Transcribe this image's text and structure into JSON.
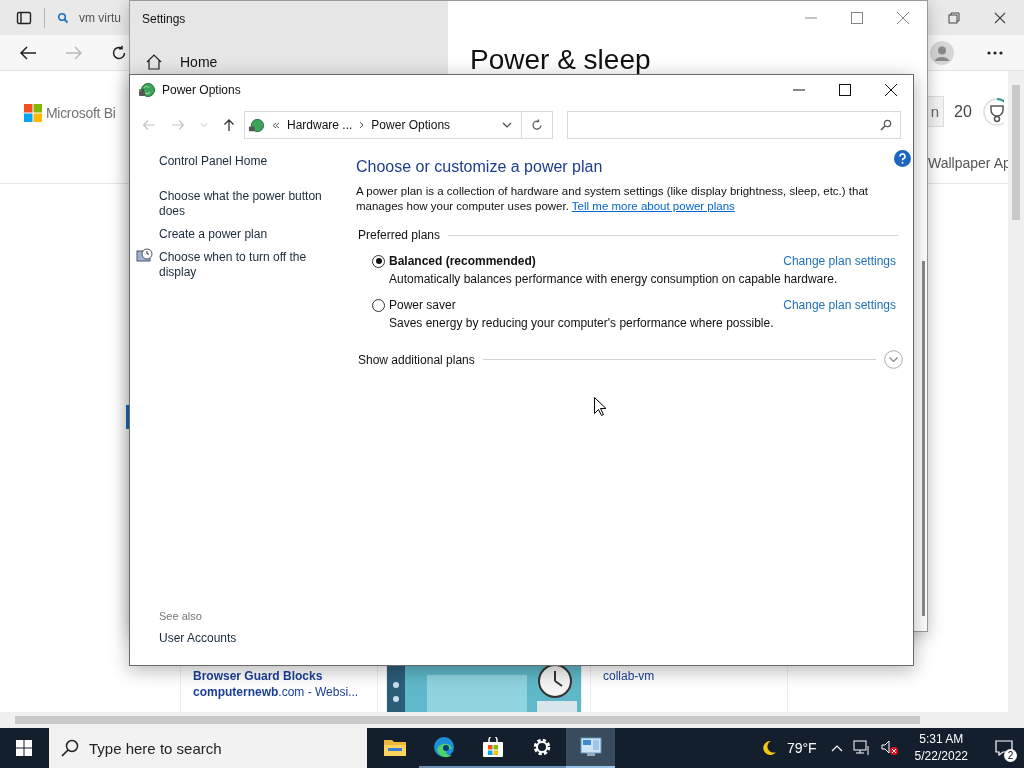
{
  "browser": {
    "tab_title": "vm virtu",
    "logo_text": "Microsoft Bi",
    "points_button": "n",
    "points": "20",
    "side_link": "Wallpaper Ap",
    "cards": [
      {
        "kind": "result",
        "title": "Browser Guard Blocks",
        "source": "**computernewb**.com - Websi..."
      },
      {
        "kind": "picture"
      },
      {
        "kind": "label",
        "title": "collab-vm"
      }
    ]
  },
  "settings_window": {
    "title": "Settings",
    "nav_item": "Home",
    "heading": "Power & sleep"
  },
  "power_options": {
    "title": "Power Options",
    "breadcrumb": [
      "Hardware ...",
      "Power Options"
    ],
    "sidebar": {
      "items": [
        {
          "label": "Control Panel Home",
          "icon": false
        },
        {
          "label": "Choose what the power button does",
          "icon": false
        },
        {
          "label": "Create a power plan",
          "icon": false
        },
        {
          "label": "Choose when to turn off the display",
          "icon": true
        }
      ],
      "see_also_label": "See also",
      "see_also": [
        "User Accounts"
      ]
    },
    "main": {
      "heading": "Choose or customize a power plan",
      "description": "A power plan is a collection of hardware and system settings (like display brightness, sleep, etc.) that manages how your computer uses power.",
      "link": "Tell me more about power plans",
      "group_label": "Preferred plans",
      "plans": [
        {
          "name": "Balanced (recommended)",
          "description": "Automatically balances performance with energy consumption on capable hardware.",
          "action": "Change plan settings",
          "selected": true
        },
        {
          "name": "Power saver",
          "description": "Saves energy by reducing your computer's performance where possible.",
          "action": "Change plan settings",
          "selected": false
        }
      ],
      "expander": {
        "label": "Show additional plans",
        "expanded": false
      }
    }
  },
  "taskbar": {
    "search_placeholder": "Type here to search",
    "apps": [
      {
        "kind": "folder",
        "running": false,
        "selected": false
      },
      {
        "kind": "edge",
        "running": true,
        "selected": false
      },
      {
        "kind": "store",
        "running": true,
        "selected": false
      },
      {
        "kind": "settings",
        "running": true,
        "selected": false
      },
      {
        "kind": "control",
        "running": true,
        "selected": true
      }
    ],
    "weather": "79°F",
    "time": "5:31 AM",
    "date": "5/22/2022",
    "notifications": "2"
  }
}
